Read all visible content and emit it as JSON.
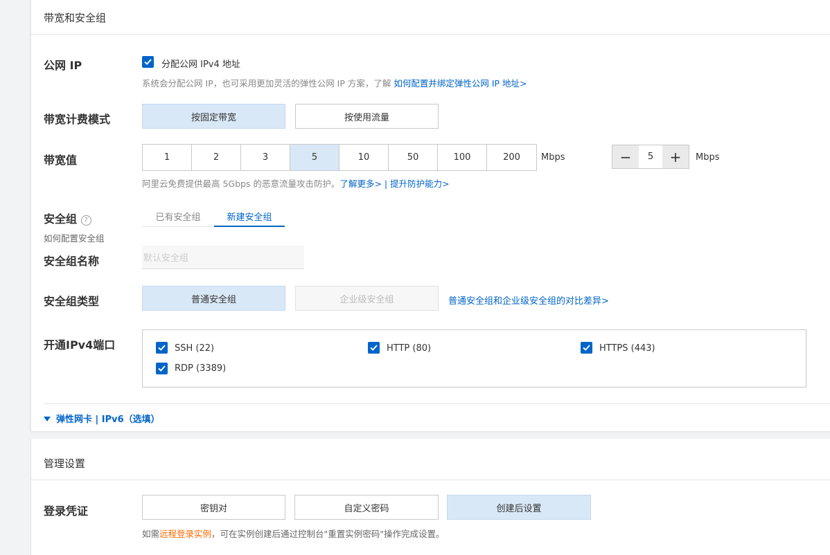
{
  "bandwidth_section": {
    "title": "带宽和安全组",
    "public_ip": {
      "label": "公网 IP",
      "checkbox_label": "分配公网 IPv4 地址",
      "hint": "系统会分配公网 IP，也可采用更加灵活的弹性公网 IP 方案，了解 ",
      "hint_link": "如何配置并绑定弹性公网 IP 地址>"
    },
    "billing_mode": {
      "label": "带宽计费模式",
      "options": [
        "按固定带宽",
        "按使用流量"
      ],
      "selected": "按固定带宽"
    },
    "bandwidth": {
      "label": "带宽值",
      "options": [
        "1",
        "2",
        "3",
        "5",
        "10",
        "50",
        "100",
        "200"
      ],
      "selected": "5",
      "unit": "Mbps",
      "stepper_value": "5",
      "stepper_unit": "Mbps",
      "hint": "阿里云免费提供最高 5Gbps 的恶意流量攻击防护。",
      "link_more": "了解更多>",
      "separator": " | ",
      "link_protect": "提升防护能力>"
    },
    "security_group": {
      "label": "安全组",
      "sub_link": "如何配置安全组",
      "tabs": [
        "已有安全组",
        "新建安全组"
      ],
      "active_tab": "新建安全组",
      "name_label": "安全组名称",
      "name_placeholder": "默认安全组",
      "type_label": "安全组类型",
      "type_options": [
        "普通安全组",
        "企业级安全组"
      ],
      "type_compare_link": "普通安全组和企业级安全组的对比差异>"
    },
    "ports": {
      "label": "开通IPv4端口",
      "items": [
        "SSH (22)",
        "HTTP (80)",
        "HTTPS (443)",
        "RDP (3389)"
      ]
    },
    "expand_link": "弹性网卡 | IPv6（选填）"
  },
  "management_section": {
    "title": "管理设置",
    "login": {
      "label": "登录凭证",
      "options": [
        "密钥对",
        "自定义密码",
        "创建后设置"
      ],
      "selected": "创建后设置",
      "hint_prefix": "如需",
      "hint_link": "远程登录实例",
      "hint_suffix": "，可在实例创建后通过控制台\"重置实例密码\"操作完成设置。"
    }
  },
  "colors": {
    "accent": "#0064c8",
    "selected_bg": "#d9e8f7",
    "link_orange": "#ff6a00"
  }
}
